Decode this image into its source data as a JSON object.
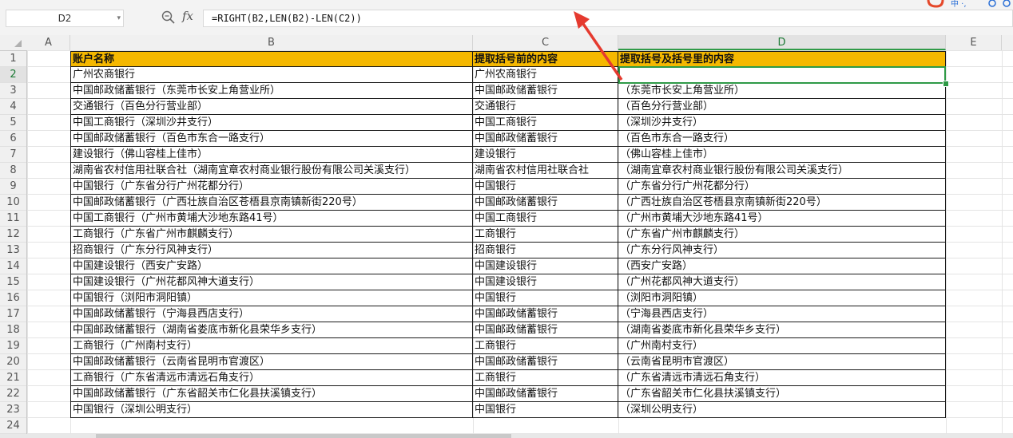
{
  "formula_bar": {
    "name_box": "D2",
    "formula": "=RIGHT(B2,LEN(B2)-LEN(C2))",
    "fx_label": "fx",
    "zoom_icon": "zoom-icon"
  },
  "columns": [
    "A",
    "B",
    "C",
    "D",
    "E"
  ],
  "selected_column": "D",
  "selected_row": "2",
  "row_numbers": [
    "1",
    "2",
    "3",
    "4",
    "5",
    "6",
    "7",
    "8",
    "9",
    "10",
    "11",
    "12",
    "13",
    "14",
    "15",
    "16",
    "17",
    "18",
    "19",
    "20",
    "21",
    "22",
    "23",
    "24"
  ],
  "table": {
    "headers": [
      "账户名称",
      "提取括号前的内容",
      "提取括号及括号里的内容"
    ],
    "rows": [
      [
        "广州农商银行",
        "广州农商银行",
        ""
      ],
      [
        "中国邮政储蓄银行（东莞市长安上角营业所）",
        "中国邮政储蓄银行",
        "（东莞市长安上角营业所）"
      ],
      [
        "交通银行（百色分行营业部）",
        "交通银行",
        "（百色分行营业部）"
      ],
      [
        "中国工商银行（深圳沙井支行）",
        "中国工商银行",
        "（深圳沙井支行）"
      ],
      [
        "中国邮政储蓄银行（百色市东合一路支行）",
        "中国邮政储蓄银行",
        "（百色市东合一路支行）"
      ],
      [
        "建设银行（佛山容桂上佳市）",
        "建设银行",
        "（佛山容桂上佳市）"
      ],
      [
        "湖南省农村信用社联合社（湖南宜章农村商业银行股份有限公司关溪支行）",
        "湖南省农村信用社联合社",
        "（湖南宜章农村商业银行股份有限公司关溪支行）"
      ],
      [
        "中国银行（广东省分行广州花都分行）",
        "中国银行",
        "（广东省分行广州花都分行）"
      ],
      [
        "中国邮政储蓄银行（广西壮族自治区苍梧县京南镇新街220号）",
        "中国邮政储蓄银行",
        "（广西壮族自治区苍梧县京南镇新街220号）"
      ],
      [
        "中国工商银行（广州市黄埔大沙地东路41号）",
        "中国工商银行",
        "（广州市黄埔大沙地东路41号）"
      ],
      [
        "工商银行（广东省广州市麒麟支行）",
        "工商银行",
        "（广东省广州市麒麟支行）"
      ],
      [
        "招商银行（广东分行风神支行）",
        "招商银行",
        "（广东分行风神支行）"
      ],
      [
        "中国建设银行（西安广安路）",
        "中国建设银行",
        "（西安广安路）"
      ],
      [
        "中国建设银行（广州花都风神大道支行）",
        "中国建设银行",
        "（广州花都风神大道支行）"
      ],
      [
        "中国银行（浏阳市洞阳镇）",
        "中国银行",
        "（浏阳市洞阳镇）"
      ],
      [
        "中国邮政储蓄银行（宁海县西店支行）",
        "中国邮政储蓄银行",
        "（宁海县西店支行）"
      ],
      [
        "中国邮政储蓄银行（湖南省娄底市新化县荣华乡支行）",
        "中国邮政储蓄银行",
        "（湖南省娄底市新化县荣华乡支行）"
      ],
      [
        "工商银行（广州南村支行）",
        "工商银行",
        "（广州南村支行）"
      ],
      [
        "中国邮政储蓄银行（云南省昆明市官渡区）",
        "中国邮政储蓄银行",
        "（云南省昆明市官渡区）"
      ],
      [
        "工商银行（广东省清远市清远石角支行）",
        "工商银行",
        "（广东省清远市清远石角支行）"
      ],
      [
        "中国邮政储蓄银行（广东省韶关市仁化县扶溪镇支行）",
        "中国邮政储蓄银行",
        "（广东省韶关市仁化县扶溪镇支行）"
      ],
      [
        "中国银行（深圳公明支行）",
        "中国银行",
        "（深圳公明支行）"
      ]
    ]
  },
  "colors": {
    "header_fill": "#f5b800",
    "selection": "#2f9a47",
    "arrow": "#e53a2f"
  }
}
